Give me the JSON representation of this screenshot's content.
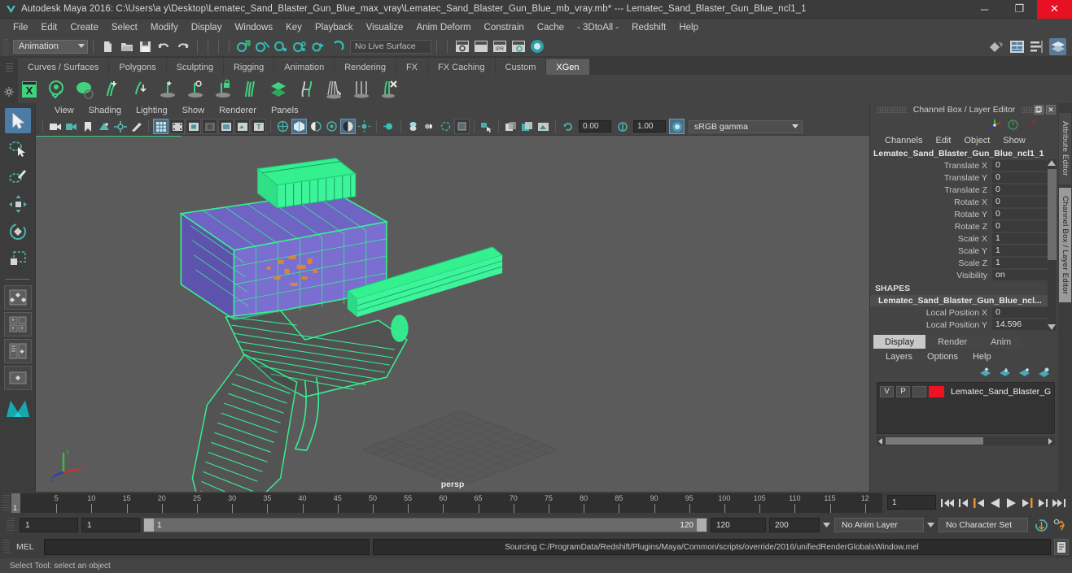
{
  "titlebar": {
    "app_title": "Autodesk Maya 2016: C:\\Users\\a y\\Desktop\\Lematec_Sand_Blaster_Gun_Blue_max_vray\\Lematec_Sand_Blaster_Gun_Blue_mb_vray.mb*  ---  Lematec_Sand_Blaster_Gun_Blue_ncl1_1",
    "minimize": "─",
    "maximize": "❐",
    "close": "✕",
    "close_color": "#e81123"
  },
  "menubar": {
    "items": [
      "File",
      "Edit",
      "Create",
      "Select",
      "Modify",
      "Display",
      "Windows",
      "Key",
      "Playback",
      "Visualize",
      "Anim Deform",
      "Constrain",
      "Cache",
      "- 3DtoAll -",
      "Redshift",
      "Help"
    ]
  },
  "statusline": {
    "mode_menu": "Animation",
    "live_surface": "No Live Surface"
  },
  "shelf": {
    "tabs": [
      "Curves / Surfaces",
      "Polygons",
      "Sculpting",
      "Rigging",
      "Animation",
      "Rendering",
      "FX",
      "FX Caching",
      "Custom",
      "XGen"
    ],
    "active_tab": "XGen"
  },
  "viewport": {
    "menus": [
      "View",
      "Shading",
      "Lighting",
      "Show",
      "Renderer",
      "Panels"
    ],
    "exposure_value": "0.00",
    "gamma_value": "1.00",
    "color_profile": "sRGB gamma",
    "camera_label": "persp",
    "background_color": "#5b5b5b",
    "wireframe_color": "#35f08f",
    "shaded_color": "#6a5fbf"
  },
  "channelbox": {
    "panel_title": "Channel Box / Layer Editor",
    "menus": [
      "Channels",
      "Edit",
      "Object",
      "Show"
    ],
    "object_name": "Lematec_Sand_Blaster_Gun_Blue_ncl1_1",
    "transform_attrs": [
      {
        "label": "Translate X",
        "value": "0"
      },
      {
        "label": "Translate Y",
        "value": "0"
      },
      {
        "label": "Translate Z",
        "value": "0"
      },
      {
        "label": "Rotate X",
        "value": "0"
      },
      {
        "label": "Rotate Y",
        "value": "0"
      },
      {
        "label": "Rotate Z",
        "value": "0"
      },
      {
        "label": "Scale X",
        "value": "1"
      },
      {
        "label": "Scale Y",
        "value": "1"
      },
      {
        "label": "Scale Z",
        "value": "1"
      },
      {
        "label": "Visibility",
        "value": "on"
      }
    ],
    "shapes_header": "SHAPES",
    "shape_name": "Lematec_Sand_Blaster_Gun_Blue_ncl...",
    "shape_attrs": [
      {
        "label": "Local Position X",
        "value": "0"
      },
      {
        "label": "Local Position Y",
        "value": "14.596"
      }
    ]
  },
  "layereditor": {
    "tabs": [
      "Display",
      "Render",
      "Anim"
    ],
    "active_tab": "Display",
    "menus": [
      "Layers",
      "Options",
      "Help"
    ],
    "columns": [
      "V",
      "P"
    ],
    "layers": [
      {
        "visible": "V",
        "playback": "P",
        "ref": "",
        "color": "#ee1122",
        "name": "Lematec_Sand_Blaster_G"
      }
    ]
  },
  "attr_tabs": {
    "items": [
      "Attribute Editor",
      "Channel Box / Layer Editor"
    ],
    "active": "Channel Box / Layer Editor"
  },
  "timeline": {
    "current_frame": "1",
    "tick_labels": [
      "5",
      "10",
      "15",
      "20",
      "25",
      "30",
      "35",
      "40",
      "45",
      "50",
      "55",
      "60",
      "65",
      "70",
      "75",
      "80",
      "85",
      "90",
      "95",
      "100",
      "105",
      "110",
      "115",
      "12"
    ],
    "range_start": 1,
    "range_end": 120,
    "frame_field": "1"
  },
  "rangebar": {
    "anim_start": "1",
    "range_start": "1",
    "slider_start": "1",
    "slider_end": "120",
    "range_end": "120",
    "anim_end": "200",
    "anim_layer": "No Anim Layer",
    "character_set": "No Character Set"
  },
  "mel": {
    "label": "MEL",
    "input_value": "",
    "output_text": "Sourcing C:/ProgramData/Redshift/Plugins/Maya/Common/scripts/override/2016/unifiedRenderGlobalsWindow.mel"
  },
  "statusbar": {
    "message": "Select Tool: select an object"
  },
  "icons": {
    "maya_logo": "maya-logo-icon",
    "new_scene": "new-scene-icon",
    "open_scene": "open-scene-icon",
    "save_scene": "save-scene-icon",
    "undo": "undo-icon",
    "redo": "redo-icon",
    "select_tool": "select-tool-icon",
    "lasso_tool": "lasso-select-icon",
    "paint_select": "paint-select-icon",
    "move_tool": "move-tool-icon",
    "rotate_tool": "rotate-tool-icon",
    "scale_tool": "scale-tool-icon"
  }
}
